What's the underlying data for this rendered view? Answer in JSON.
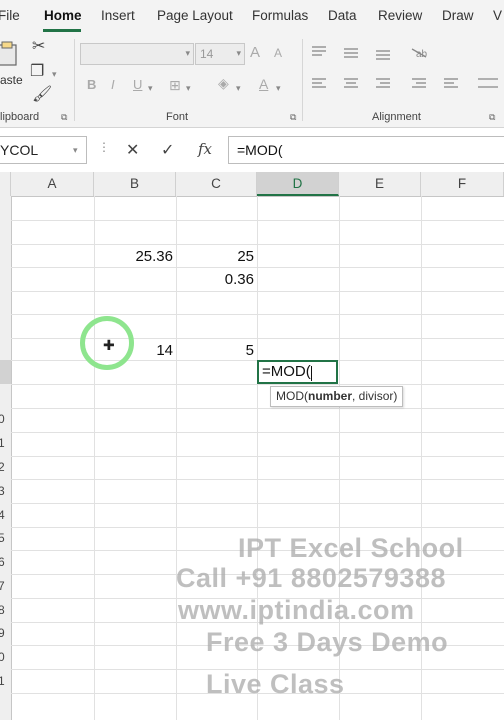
{
  "ribbon": {
    "tabs": [
      {
        "label": "File",
        "active": false
      },
      {
        "label": "Home",
        "active": true
      },
      {
        "label": "Insert",
        "active": false
      },
      {
        "label": "Page Layout",
        "active": false
      },
      {
        "label": "Formulas",
        "active": false
      },
      {
        "label": "Data",
        "active": false
      },
      {
        "label": "Review",
        "active": false
      },
      {
        "label": "Draw",
        "active": false
      },
      {
        "label": "V",
        "active": false
      }
    ],
    "clipboard": {
      "paste_label": "aste",
      "group_label": "lipboard"
    },
    "font": {
      "font_size": "14",
      "group_label": "Font",
      "grow_label": "A",
      "shrink_label": "A",
      "bold": "B",
      "italic": "I",
      "underline": "U",
      "font_color_label": "A"
    },
    "alignment": {
      "group_label": "Alignment"
    }
  },
  "formula_bar": {
    "name_box": "YCOL",
    "cancel": "✕",
    "enter": "✓",
    "fx": "fx",
    "formula": "=MOD("
  },
  "grid": {
    "columns": [
      "A",
      "B",
      "C",
      "D",
      "E",
      "F"
    ],
    "selected_column": "D",
    "row_labels": [
      "0",
      "1",
      "2",
      "3",
      "4",
      "5",
      "6",
      "7",
      "8",
      "9",
      "0",
      "1"
    ],
    "cells": {
      "b_row3": "25.36",
      "c_row3": "25",
      "c_row4": "0.36",
      "b_row7": "14",
      "c_row7": "5"
    },
    "active_cell_text": "=MOD(",
    "tooltip": {
      "func": "MOD(",
      "arg_bold": "number",
      ",rest": "",
      "rest": ", divisor)"
    }
  },
  "accent": "#217346",
  "watermark": {
    "line1": "IPT Excel School",
    "line2": "Call +91 8802579388",
    "line3": "www.iptindia.com",
    "line4": "Free 3 Days Demo",
    "line5": "Live Class"
  }
}
